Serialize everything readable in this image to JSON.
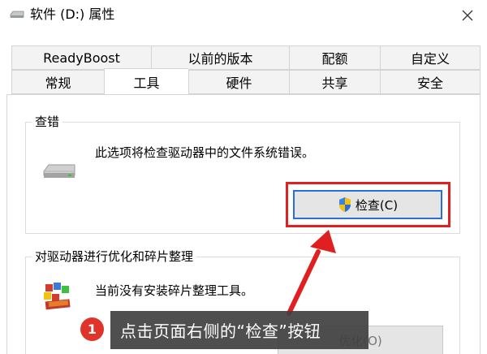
{
  "window": {
    "title": "软件 (D:) 属性",
    "close_glyph": "✕"
  },
  "tabs": {
    "row1": [
      {
        "label": "ReadyBoost"
      },
      {
        "label": "以前的版本"
      },
      {
        "label": "配额"
      },
      {
        "label": "自定义"
      }
    ],
    "row2": [
      {
        "label": "常规"
      },
      {
        "label": "工具"
      },
      {
        "label": "硬件"
      },
      {
        "label": "共享"
      },
      {
        "label": "安全"
      }
    ],
    "active": "工具"
  },
  "error_check": {
    "group_title": "查错",
    "description": "此选项将检查驱动器中的文件系统错误。",
    "button_label": "检查(C)",
    "button_icon": "uac-shield-icon"
  },
  "optimize": {
    "group_title": "对驱动器进行优化和碎片整理",
    "description": "当前没有安装碎片整理工具。",
    "button_label": "优化(O)"
  },
  "annotation": {
    "badge_number": "1",
    "text": "点击页面右侧的“检查”按钮",
    "highlight_color": "#e02020"
  },
  "colors": {
    "accent_blue": "#2a6fd6",
    "annotation_red": "#e0332a"
  }
}
